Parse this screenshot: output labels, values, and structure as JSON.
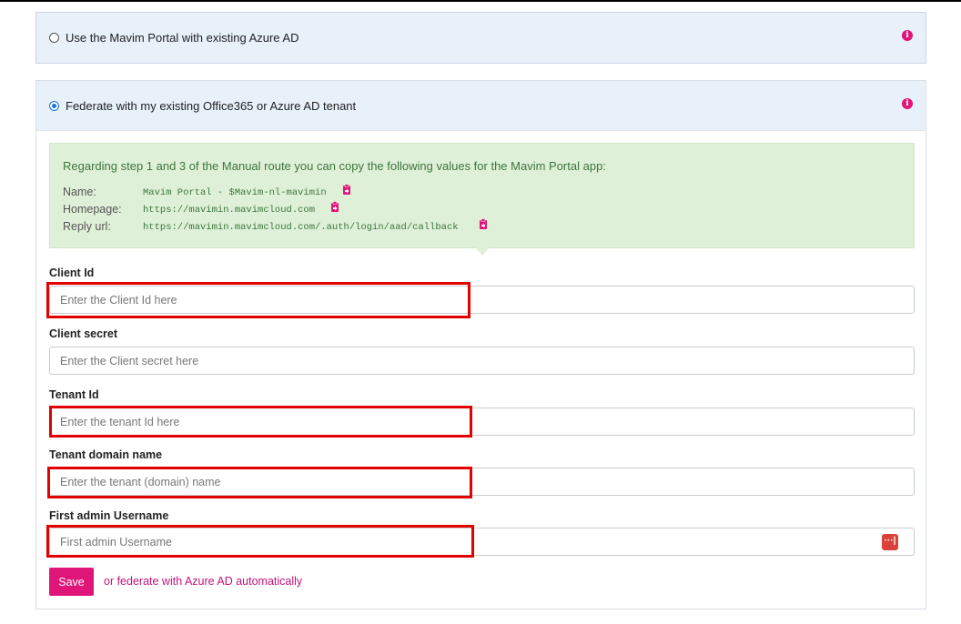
{
  "options": {
    "existing_azure_ad": {
      "label": "Use the Mavim Portal with existing Azure AD",
      "selected": false
    },
    "federate": {
      "label": "Federate with my existing Office365 or Azure AD tenant",
      "selected": true
    }
  },
  "info_box": {
    "intro": "Regarding step 1 and 3 of the Manual route you can copy the following values for the Mavim Portal app:",
    "rows": [
      {
        "key": "Name:",
        "value": "Mavim Portal - $Mavim-nl-mavimin"
      },
      {
        "key": "Homepage:",
        "value": "https://mavimin.mavimcloud.com"
      },
      {
        "key": "Reply url:",
        "value": "https://mavimin.mavimcloud.com/.auth/login/aad/callback"
      }
    ]
  },
  "fields": {
    "client_id": {
      "label": "Client Id",
      "placeholder": "Enter the Client Id here",
      "value": ""
    },
    "client_secret": {
      "label": "Client secret",
      "placeholder": "Enter the Client secret here",
      "value": ""
    },
    "tenant_id": {
      "label": "Tenant Id",
      "placeholder": "Enter the tenant Id here",
      "value": ""
    },
    "tenant_domain": {
      "label": "Tenant domain name",
      "placeholder": "Enter the tenant (domain) name",
      "value": ""
    },
    "first_admin": {
      "label": "First admin Username",
      "placeholder": "First admin Username",
      "value": ""
    }
  },
  "actions": {
    "save_label": "Save",
    "alt_link": "or federate with Azure AD automatically"
  },
  "icons": {
    "info": "info-icon",
    "copy": "clipboard-icon",
    "password_manager": "password-manager-icon"
  },
  "colors": {
    "accent": "#e0157a",
    "panel_header": "#e8f0fa",
    "info_box": "#dff0d8",
    "info_text": "#3c763d",
    "highlight": "#e30000"
  }
}
